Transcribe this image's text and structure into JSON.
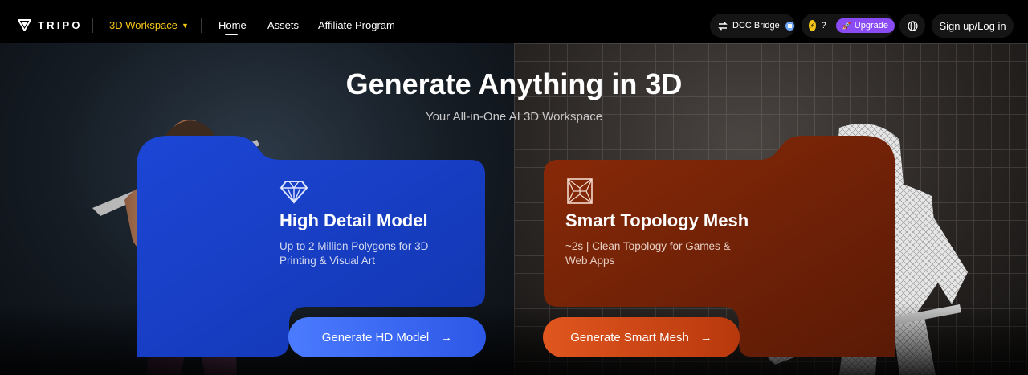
{
  "nav": {
    "logo_text": "TRIPO",
    "workspace_label": "3D Workspace",
    "items": [
      {
        "label": "Home",
        "active": true
      },
      {
        "label": "Assets"
      },
      {
        "label": "Affiliate Program"
      }
    ],
    "dcc_label": "DCC Bridge",
    "credits_value": "?",
    "upgrade_label": "Upgrade",
    "signin_label": "Sign up/Log in"
  },
  "hero": {
    "title": "Generate Anything in 3D",
    "subtitle": "Your All-in-One AI 3D Workspace"
  },
  "cards": [
    {
      "title": "High Detail Model",
      "description": "Up to 2 Million Polygons for 3D Printing & Visual Art",
      "button_label": "Generate HD Model",
      "icon": "diamond-icon",
      "color": "#2f5cf0"
    },
    {
      "title": "Smart Topology Mesh",
      "description": "~2s | Clean Topology for Games & Web Apps",
      "button_label": "Generate Smart Mesh",
      "icon": "mesh-icon",
      "color": "#b83a0f"
    }
  ],
  "colors": {
    "accent_yellow": "#f5c518",
    "upgrade_purple": "#8a4bf5",
    "hd_blue": "#2f5cf0",
    "smart_orange": "#d44a17"
  }
}
